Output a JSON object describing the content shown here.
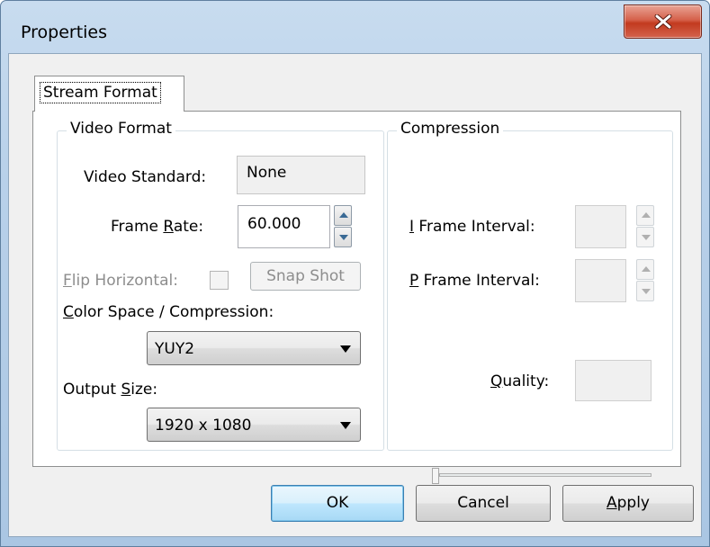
{
  "window": {
    "title": "Properties"
  },
  "tabs": [
    {
      "label": "Stream Format",
      "active": true
    }
  ],
  "video_format": {
    "group_label": "Video Format",
    "video_standard_label": "Video Standard:",
    "video_standard_value": "None",
    "frame_rate_label_pre": "Frame ",
    "frame_rate_label_u": "R",
    "frame_rate_label_post": "ate:",
    "frame_rate_value": "60.000",
    "flip_label_u": "F",
    "flip_label_post": "lip Horizontal:",
    "flip_checked": false,
    "snap_shot_label": "Snap Shot",
    "color_space_label_u": "C",
    "color_space_label_post": "olor Space / Compression:",
    "color_space_value": "YUY2",
    "output_size_label_pre": "Output ",
    "output_size_label_u": "S",
    "output_size_label_post": "ize:",
    "output_size_value": "1920 x 1080"
  },
  "compression": {
    "group_label": "Compression",
    "i_frame_label_u": "I",
    "i_frame_label_post": " Frame Interval:",
    "i_frame_value": "",
    "p_frame_label_u": "P",
    "p_frame_label_post": " Frame Interval:",
    "p_frame_value": "",
    "quality_label_u": "Q",
    "quality_label_post": "uality:",
    "quality_value": "",
    "quality_slider": 0
  },
  "buttons": {
    "ok": "OK",
    "cancel": "Cancel",
    "apply_u": "A",
    "apply_post": "pply"
  },
  "colors": {
    "title_bar": "#b9d1ea",
    "close_button": "#c23a1f",
    "dialog_bg": "#f0f0f0",
    "default_button": "#bee6fd"
  }
}
